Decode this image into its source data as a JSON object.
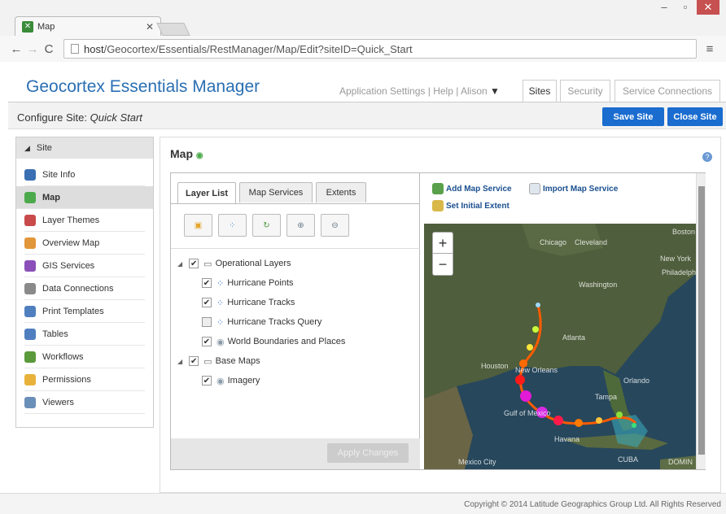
{
  "browser": {
    "tab_title": "Map",
    "url_prefix": "host",
    "url_path": "/Geocortex/Essentials/RestManager/Map/Edit?siteID=Quick_Start"
  },
  "app": {
    "brand": "Geocortex Essentials Manager",
    "top_links": {
      "settings": "Application Settings",
      "help": "Help",
      "user": "Alison"
    },
    "nav_tabs": [
      "Sites",
      "Security",
      "Service Connections"
    ]
  },
  "config": {
    "title_prefix": "Configure Site:",
    "site_name": "Quick Start",
    "save_label": "Save Site",
    "close_label": "Close Site"
  },
  "sidebar": {
    "header": "Site",
    "items": [
      {
        "label": "Site Info",
        "color": "#3a6fb3"
      },
      {
        "label": "Map",
        "color": "#4caa4c"
      },
      {
        "label": "Layer Themes",
        "color": "#c84a4a"
      },
      {
        "label": "Overview Map",
        "color": "#e2963a"
      },
      {
        "label": "GIS Services",
        "color": "#8a4fb8"
      },
      {
        "label": "Data Connections",
        "color": "#8a8a8a"
      },
      {
        "label": "Print Templates",
        "color": "#4f7fbf"
      },
      {
        "label": "Tables",
        "color": "#4f7fbf"
      },
      {
        "label": "Workflows",
        "color": "#5a9a3a"
      },
      {
        "label": "Permissions",
        "color": "#e8b23a"
      },
      {
        "label": "Viewers",
        "color": "#6a8fb8"
      }
    ]
  },
  "content": {
    "title": "Map",
    "tabs": [
      "Layer List",
      "Map Services",
      "Extents"
    ],
    "layers": [
      {
        "label": "Operational Layers",
        "checked": true,
        "kind": "group"
      },
      {
        "label": "Hurricane Points",
        "checked": true,
        "kind": "layer"
      },
      {
        "label": "Hurricane Tracks",
        "checked": true,
        "kind": "layer"
      },
      {
        "label": "Hurricane Tracks Query",
        "checked": false,
        "kind": "layer"
      },
      {
        "label": "World Boundaries and Places",
        "checked": true,
        "kind": "service"
      },
      {
        "label": "Base Maps",
        "checked": true,
        "kind": "group"
      },
      {
        "label": "Imagery",
        "checked": true,
        "kind": "service"
      }
    ],
    "apply_label": "Apply Changes",
    "add_service": "Add Map Service",
    "import_service": "Import Map Service",
    "set_extent": "Set Initial Extent"
  },
  "map": {
    "labels": [
      "Chicago",
      "Cleveland",
      "Boston",
      "New York",
      "Philadelphia",
      "Washington",
      "Atlanta",
      "Houston",
      "New Orleans",
      "Orlando",
      "Tampa",
      "Gulf of Mexico",
      "Havana",
      "Mexico City",
      "CUBA",
      "DOMIN"
    ],
    "zoom_in": "+",
    "zoom_out": "−"
  },
  "footer": {
    "copyright": "Copyright © 2014 Latitude Geographics Group Ltd. All Rights Reserved"
  }
}
